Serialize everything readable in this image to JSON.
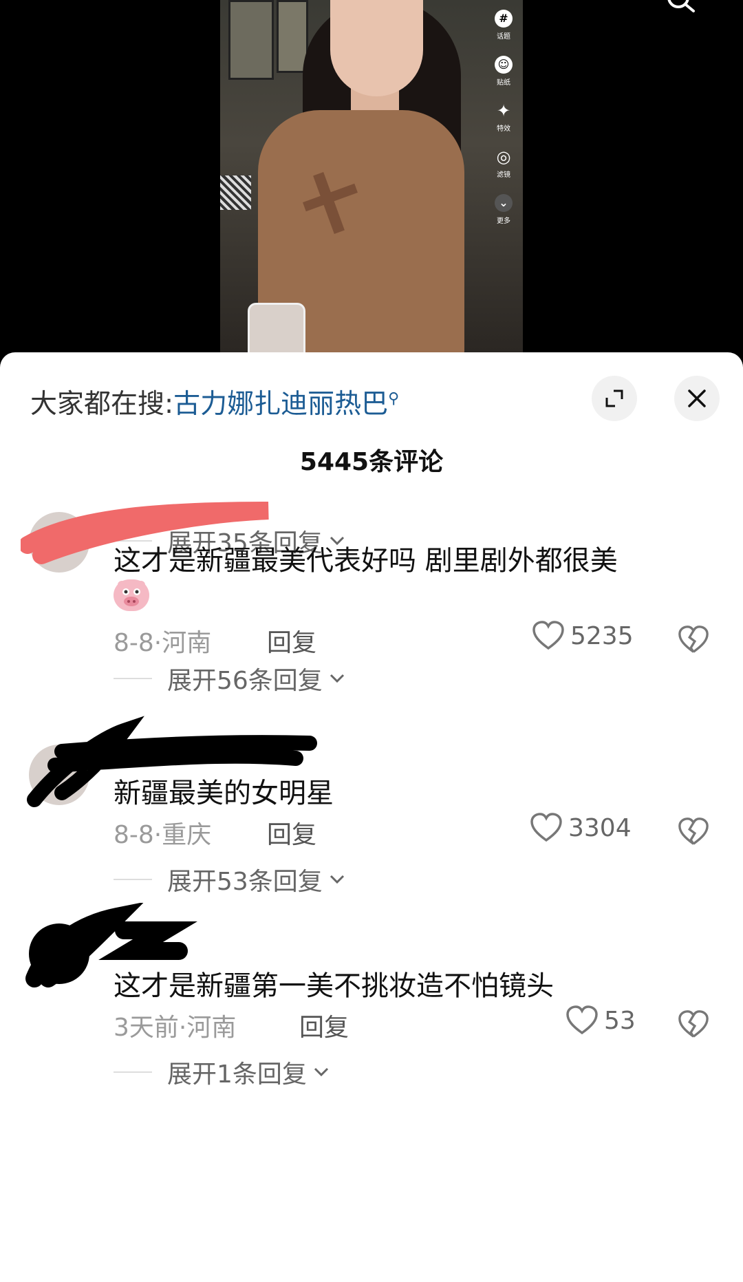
{
  "video": {
    "tools": [
      {
        "icon": "hashtag-icon",
        "glyph": "#",
        "label": "话题"
      },
      {
        "icon": "sticker-icon",
        "glyph": "☺",
        "label": "贴纸"
      },
      {
        "icon": "effects-icon",
        "glyph": "✦",
        "label": "特效"
      },
      {
        "icon": "filter-icon",
        "glyph": "◎",
        "label": "滤镜"
      },
      {
        "icon": "more-icon",
        "glyph": "⌄",
        "label": "更多"
      }
    ]
  },
  "panel": {
    "search_prefix": "大家都在搜:",
    "search_query": "古力娜扎迪丽热巴",
    "comment_count": "5445条评论",
    "top_replies": "展开35条回复"
  },
  "comments": [
    {
      "text_line1": "这才是新疆最美代表好吗  剧里剧外都很美",
      "date": "8-8·",
      "location": "河南",
      "reply": "回复",
      "likes": "5235",
      "replies": "展开56条回复"
    },
    {
      "text_line1": "新疆最美的女明星",
      "date": "8-8·",
      "location": "重庆",
      "reply": "回复",
      "likes": "3304",
      "replies": "展开53条回复"
    },
    {
      "text_line1": "这才是新疆第一美不挑妆造不怕镜头",
      "date": "3天前",
      "location": "·河南",
      "reply": "回复",
      "likes": "53",
      "replies": "展开1条回复"
    }
  ]
}
